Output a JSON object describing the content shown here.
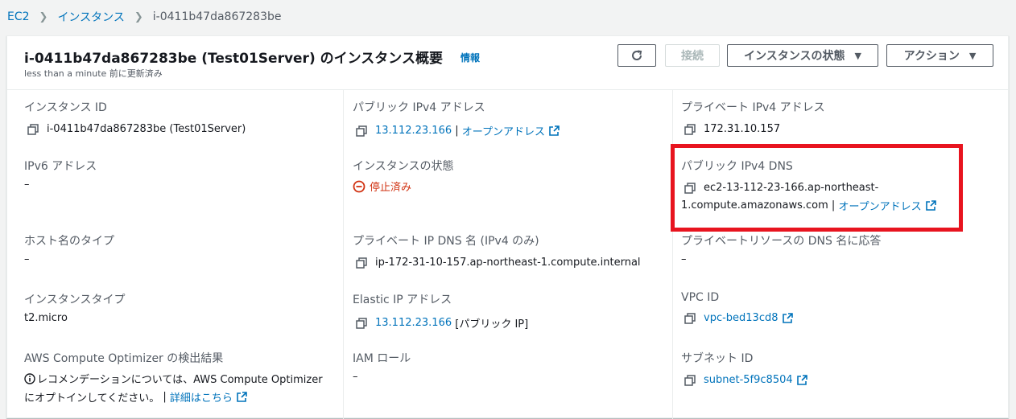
{
  "breadcrumb": {
    "items": [
      "EC2",
      "インスタンス"
    ],
    "current": "i-0411b47da867283be"
  },
  "header": {
    "title": "i-0411b47da867283be (Test01Server) のインスタンス概要",
    "info": "情報",
    "subtitle": "less than a minute 前に更新済み",
    "connect_label": "接続",
    "state_menu_label": "インスタンスの状態",
    "actions_label": "アクション"
  },
  "details": {
    "instance_id": {
      "label": "インスタンス ID",
      "value": "i-0411b47da867283be (Test01Server)"
    },
    "public_ipv4": {
      "label": "パブリック IPv4 アドレス",
      "value": "13.112.23.166",
      "sep": " | ",
      "open": "オープンアドレス"
    },
    "private_ipv4": {
      "label": "プライベート IPv4 アドレス",
      "value": "172.31.10.157"
    },
    "ipv6": {
      "label": "IPv6 アドレス",
      "value": "–"
    },
    "state": {
      "label": "インスタンスの状態",
      "value": "停止済み"
    },
    "public_dns": {
      "label": "パブリック IPv4 DNS",
      "value_line1": "ec2-13-112-23-166.ap-northeast-",
      "value_line2": "1.compute.amazonaws.com",
      "sep": " | ",
      "open": "オープンアドレス"
    },
    "hostname_type": {
      "label": "ホスト名のタイプ",
      "value": "–"
    },
    "private_dns": {
      "label": "プライベート IP DNS 名 (IPv4 のみ)",
      "value": "ip-172-31-10-157.ap-northeast-1.compute.internal"
    },
    "private_resource_dns": {
      "label": "プライベートリソースの DNS 名に応答",
      "value": "–"
    },
    "instance_type": {
      "label": "インスタンスタイプ",
      "value": "t2.micro"
    },
    "elastic_ip": {
      "label": "Elastic IP アドレス",
      "value": "13.112.23.166",
      "suffix": " [パブリック IP]"
    },
    "vpc": {
      "label": "VPC ID",
      "value": "vpc-bed13cd8"
    },
    "optimizer": {
      "label": "AWS Compute Optimizer の検出結果",
      "line1": "レコメンデーションについては、AWS Compute Optimizer",
      "line2": "にオプトインしてください。",
      "sep": " | ",
      "link": "詳細はこちら"
    },
    "iam_role": {
      "label": "IAM ロール",
      "value": "–"
    },
    "subnet": {
      "label": "サブネット ID",
      "value": "subnet-5f9c8504"
    }
  },
  "colors": {
    "link": "#0073bb",
    "stopped": "#d13212",
    "highlight": "#e8141f"
  }
}
